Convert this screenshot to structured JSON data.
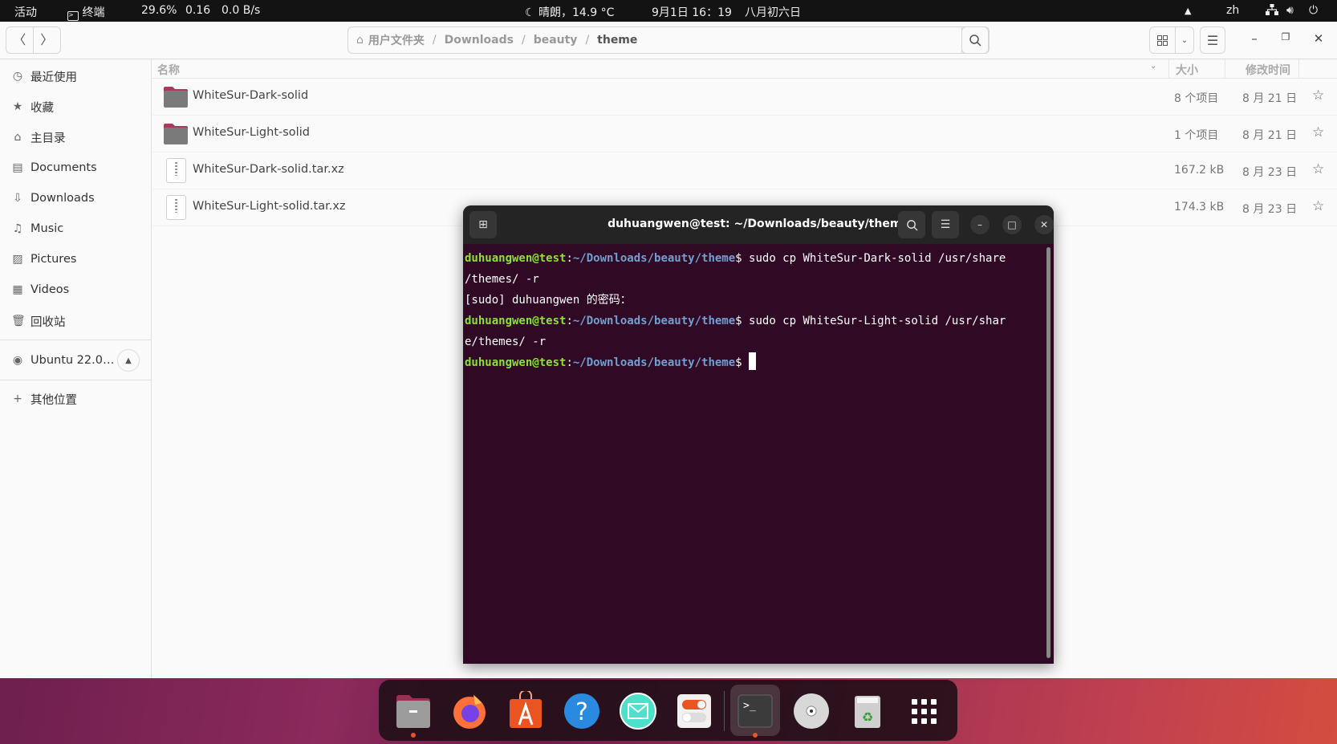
{
  "topbar": {
    "activities": "活动",
    "app_name": "终端",
    "cpu": "29.6%",
    "load": "0.16",
    "net": "0.0 B/s",
    "weather": "晴朗，14.9 °C",
    "datetime": "9月1日  16：19",
    "lunar": "八月初六日",
    "input_method": "zh",
    "icons": [
      "eject-icon",
      "network-icon",
      "volume-icon",
      "power-icon"
    ]
  },
  "files": {
    "path": [
      {
        "label": "用户文件夹",
        "icon": "home-icon"
      },
      {
        "label": "Downloads"
      },
      {
        "label": "beauty"
      },
      {
        "label": "theme",
        "current": true
      }
    ],
    "columns": {
      "name": "名称",
      "size": "大小",
      "modified": "修改时间"
    },
    "rows": [
      {
        "name": "WhiteSur-Dark-solid",
        "type": "folder",
        "size": "8 个项目",
        "modified": "8 月 21 日",
        "starred": false
      },
      {
        "name": "WhiteSur-Light-solid",
        "type": "folder",
        "size": "1 个项目",
        "modified": "8 月 21 日",
        "starred": false
      },
      {
        "name": "WhiteSur-Dark-solid.tar.xz",
        "type": "archive",
        "size": "167.2 kB",
        "modified": "8 月 23 日",
        "starred": false
      },
      {
        "name": "WhiteSur-Light-solid.tar.xz",
        "type": "archive",
        "size": "174.3 kB",
        "modified": "8 月 23 日",
        "starred": false
      }
    ]
  },
  "sidebar": {
    "items": [
      {
        "label": "最近使用",
        "icon": "clock-icon"
      },
      {
        "label": "收藏",
        "icon": "star-icon"
      },
      {
        "label": "主目录",
        "icon": "home-icon"
      },
      {
        "label": "Documents",
        "icon": "document-icon"
      },
      {
        "label": "Downloads",
        "icon": "download-icon"
      },
      {
        "label": "Music",
        "icon": "music-icon"
      },
      {
        "label": "Pictures",
        "icon": "picture-icon"
      },
      {
        "label": "Videos",
        "icon": "video-icon"
      },
      {
        "label": "回收站",
        "icon": "trash-icon"
      }
    ],
    "device": {
      "label": "Ubuntu 22.0…",
      "icon": "disc-icon"
    },
    "other": {
      "label": "其他位置",
      "icon": "plus-icon"
    }
  },
  "terminal": {
    "title": "duhuangwen@test: ~/Downloads/beauty/theme",
    "prompt_user": "duhuangwen@test",
    "prompt_path": "~/Downloads/beauty/theme",
    "lines": [
      {
        "type": "cmd",
        "cmd": " sudo cp WhiteSur-Dark-solid /usr/share\n/themes/ -r"
      },
      {
        "type": "out",
        "text": "[sudo] duhuangwen 的密码："
      },
      {
        "type": "cmd",
        "cmd": " sudo cp WhiteSur-Light-solid /usr/shar\ne/themes/ -r"
      },
      {
        "type": "cmd",
        "cmd": " "
      }
    ]
  },
  "dock": {
    "apps": [
      {
        "name": "files",
        "running": true
      },
      {
        "name": "firefox",
        "running": false
      },
      {
        "name": "software",
        "running": false
      },
      {
        "name": "help",
        "running": false
      },
      {
        "name": "mail",
        "running": false
      },
      {
        "name": "settings-toggle",
        "running": false
      },
      {
        "name": "terminal",
        "running": true,
        "active": true
      },
      {
        "name": "disc",
        "running": false
      },
      {
        "name": "trash",
        "running": false
      },
      {
        "name": "app-grid",
        "running": false
      }
    ]
  }
}
